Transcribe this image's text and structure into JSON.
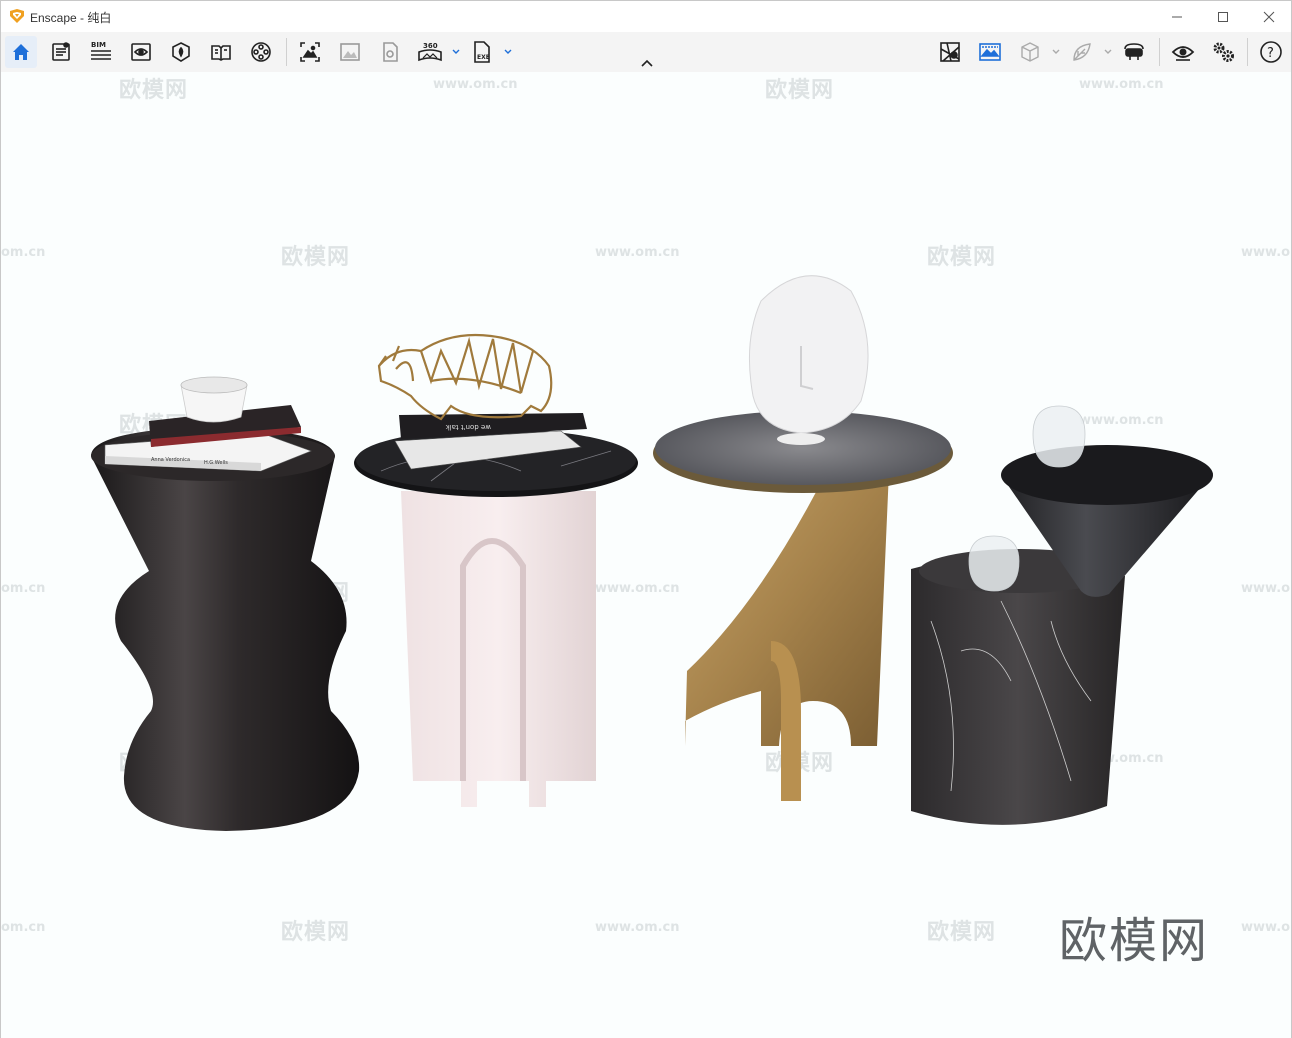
{
  "window": {
    "title": "Enscape - 纯白",
    "controls": [
      "minimize",
      "maximize",
      "close"
    ]
  },
  "toolbar": {
    "left_group_1": [
      {
        "icon": "home-icon",
        "active": true
      },
      {
        "icon": "document-list-icon"
      },
      {
        "icon": "bim-icon",
        "label": "BIM"
      },
      {
        "icon": "view-eye-icon"
      },
      {
        "icon": "asset-library-icon"
      },
      {
        "icon": "material-book-icon"
      },
      {
        "icon": "video-reel-icon"
      }
    ],
    "left_group_2": [
      {
        "icon": "screenshot-icon"
      },
      {
        "icon": "render-image-icon"
      },
      {
        "icon": "batch-render-icon"
      },
      {
        "icon": "panorama-360-icon",
        "label": "360"
      },
      {
        "icon": "export-exe-icon",
        "label": "EXE"
      }
    ],
    "right_group": [
      {
        "icon": "map-icon"
      },
      {
        "icon": "background-image-icon"
      },
      {
        "icon": "cube-view-icon"
      },
      {
        "icon": "leaf-icon"
      },
      {
        "icon": "vr-headset-icon"
      },
      {
        "icon": "visibility-eye-icon"
      },
      {
        "icon": "settings-gears-icon"
      },
      {
        "icon": "help-icon",
        "label": "?"
      }
    ]
  },
  "viewport": {
    "watermark_cn": "欧模网",
    "watermark_url": "www.om.cn",
    "watermark_url_clipped": "om.cn",
    "brand_text": "欧模网",
    "book_titles": [
      "Anna Verdonica",
      "H.G.Wells"
    ],
    "book_spine": "we don't talk"
  },
  "colors": {
    "accent": "#1e6fd9",
    "logo_orange": "#f0a020",
    "viewport_bg": "#fbfefe"
  }
}
